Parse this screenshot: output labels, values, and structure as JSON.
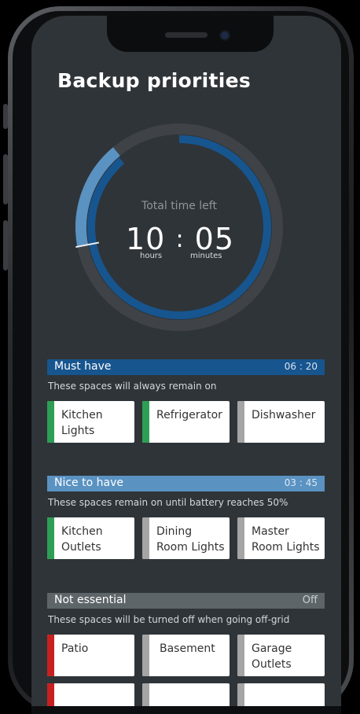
{
  "app": {
    "title": "Backup priorities"
  },
  "timer": {
    "label": "Total time left",
    "hours": "10",
    "separator": ":",
    "minutes": "05",
    "hours_unit": "hours",
    "minutes_unit": "minutes",
    "must_fraction": 0.72,
    "nice_fraction": 0.17,
    "colors": {
      "must": "#17558f",
      "nice": "#5a92c2",
      "track": "#3f4347"
    }
  },
  "sections": [
    {
      "name": "Must have",
      "time": "06 : 20",
      "desc": "These spaces will always remain on",
      "bar_color": "#17558f",
      "items": [
        {
          "label": "Kitchen Lights",
          "strip": "#2e9e55"
        },
        {
          "label": "Refrigerator",
          "strip": "#2e9e55"
        },
        {
          "label": "Dishwasher",
          "strip": "#a5a5a5"
        }
      ]
    },
    {
      "name": "Nice to have",
      "time": "03 : 45",
      "desc": "These spaces remain on until battery reaches 50%",
      "bar_color": "#5a92c2",
      "items": [
        {
          "label": "Kitchen Outlets",
          "strip": "#2e9e55"
        },
        {
          "label": "Dining Room Lights",
          "strip": "#a5a5a5"
        },
        {
          "label": "Master Room Lights",
          "strip": "#a5a5a5"
        }
      ]
    },
    {
      "name": "Not essential",
      "time": "Off",
      "desc": "These spaces will be turned off when going off-grid",
      "bar_color": "#5e6569",
      "items": [
        {
          "label": "Patio",
          "strip": "#c82020"
        },
        {
          "label": "Basement",
          "strip": "#a5a5a5"
        },
        {
          "label": "Garage Outlets",
          "strip": "#a5a5a5"
        }
      ],
      "partial_items": [
        {
          "strip": "#c82020"
        },
        {
          "strip": "#a5a5a5"
        },
        {
          "strip": "#a5a5a5"
        }
      ]
    }
  ]
}
